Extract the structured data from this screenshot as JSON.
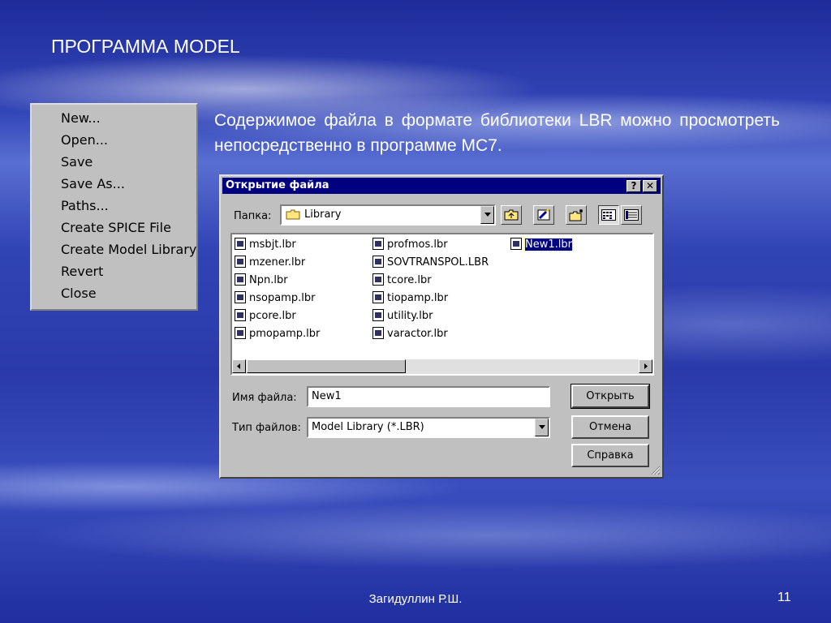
{
  "slide": {
    "title": "ПРОГРАММА MODEL",
    "body": "Содержимое файла в формате библиотеки LBR можно просмотреть непосредственно в программе MC7.",
    "author": "Загидуллин Р.Ш.",
    "page": "11"
  },
  "menu": {
    "items": [
      "New...",
      "Open...",
      "Save",
      "Save As...",
      "Paths...",
      "Create SPICE File",
      "Create Model Library",
      "Revert",
      "Close"
    ]
  },
  "dialog": {
    "title": "Открытие файла",
    "help_button": "?",
    "close_button": "✕",
    "folder_label": "Папка:",
    "folder_value": "Library",
    "files": [
      {
        "name": "msbjt.lbr"
      },
      {
        "name": "mzener.lbr"
      },
      {
        "name": "Npn.lbr"
      },
      {
        "name": "nsopamp.lbr"
      },
      {
        "name": "pcore.lbr"
      },
      {
        "name": "pmopamp.lbr"
      },
      {
        "name": "profmos.lbr"
      },
      {
        "name": "SOVTRANSPOL.LBR"
      },
      {
        "name": "tcore.lbr"
      },
      {
        "name": "tiopamp.lbr"
      },
      {
        "name": "utility.lbr"
      },
      {
        "name": "varactor.lbr"
      },
      {
        "name": "New1.lbr",
        "selected": true
      }
    ],
    "filename_label": "Имя файла:",
    "filename_value": "New1",
    "filetype_label": "Тип файлов:",
    "filetype_value": "Model Library (*.LBR)",
    "open_button": "Открыть",
    "cancel_button": "Отмена",
    "help_label": "Справка",
    "icons": [
      "up-folder-icon",
      "desktop-icon",
      "new-folder-icon",
      "list-view-icon",
      "details-view-icon"
    ]
  }
}
